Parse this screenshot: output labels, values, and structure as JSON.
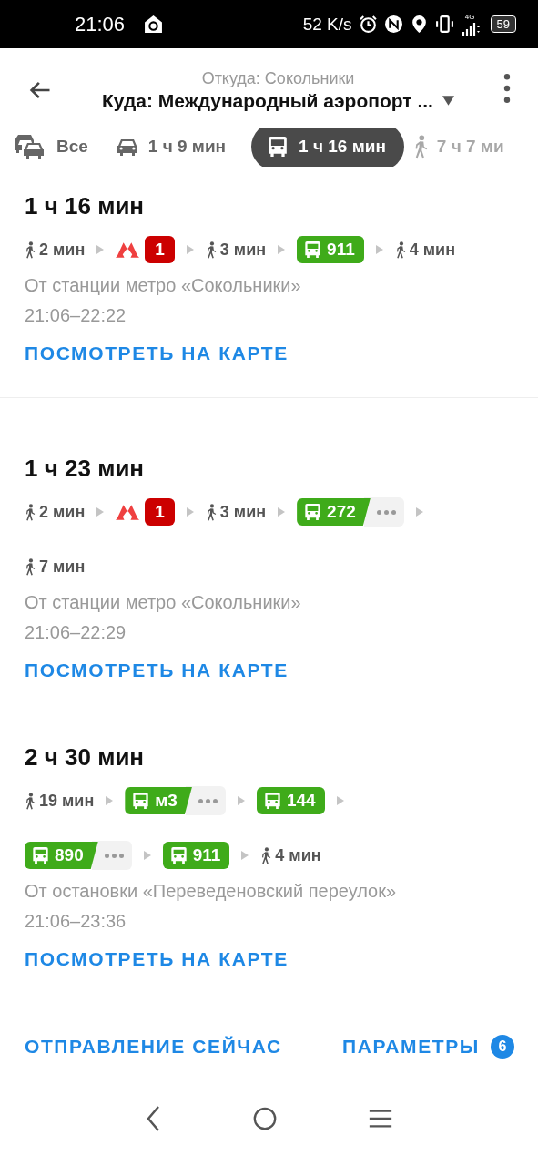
{
  "status_bar": {
    "time": "21:06",
    "speed": "52 K/s",
    "network": "4G",
    "battery": "59"
  },
  "header": {
    "from": "Откуда: Сокольники",
    "to": "Куда: Международный аэропорт ..."
  },
  "tabs": [
    {
      "kind": "all",
      "label": "Все",
      "selected": false,
      "faded": false
    },
    {
      "kind": "car",
      "label": "1 ч 9 мин",
      "selected": false,
      "faded": false
    },
    {
      "kind": "bus",
      "label": "1 ч 16 мин",
      "selected": true,
      "faded": false
    },
    {
      "kind": "walk",
      "label": "7 ч 7 ми",
      "selected": false,
      "faded": true
    }
  ],
  "routes": [
    {
      "duration": "1 ч 16 мин",
      "segments": [
        {
          "kind": "walk",
          "label": "2 мин"
        },
        {
          "kind": "metro",
          "label": "1",
          "color": "#cc0000"
        },
        {
          "kind": "walk",
          "label": "3 мин"
        },
        {
          "kind": "bus",
          "label": "911",
          "alternatives": false
        },
        {
          "kind": "walk",
          "label": "4 мин"
        }
      ],
      "from": "От станции метро «Сокольники»",
      "times": "21:06–22:22",
      "link": "ПОСМОТРЕТЬ НА КАРТЕ"
    },
    {
      "duration": "1 ч 23 мин",
      "segments": [
        {
          "kind": "walk",
          "label": "2 мин"
        },
        {
          "kind": "metro",
          "label": "1",
          "color": "#cc0000"
        },
        {
          "kind": "walk",
          "label": "3 мин"
        },
        {
          "kind": "bus",
          "label": "272",
          "alternatives": true
        },
        {
          "kind": "walk",
          "label": "7 мин"
        }
      ],
      "from": "От станции метро «Сокольники»",
      "times": "21:06–22:29",
      "link": "ПОСМОТРЕТЬ НА КАРТЕ"
    },
    {
      "duration": "2 ч 30 мин",
      "segments": [
        {
          "kind": "walk",
          "label": "19 мин"
        },
        {
          "kind": "bus",
          "label": "м3",
          "alternatives": true
        },
        {
          "kind": "bus",
          "label": "144",
          "alternatives": false
        },
        {
          "kind": "bus",
          "label": "890",
          "alternatives": true
        },
        {
          "kind": "bus",
          "label": "911",
          "alternatives": false
        },
        {
          "kind": "walk",
          "label": "4 мин"
        }
      ],
      "from": "От остановки «Переведеновский переулок»",
      "times": "21:06–23:36",
      "link": "ПОСМОТРЕТЬ НА КАРТЕ"
    }
  ],
  "footer": {
    "depart": "ОТПРАВЛЕНИЕ СЕЙЧАС",
    "params": "ПАРАМЕТРЫ",
    "params_count": "6"
  }
}
